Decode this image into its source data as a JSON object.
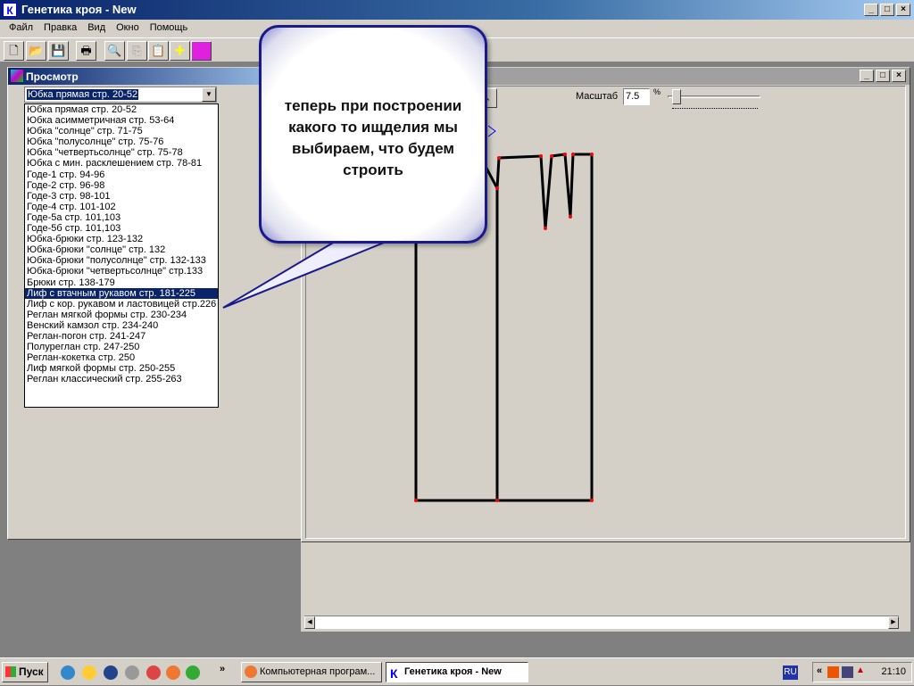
{
  "app": {
    "title": "Генетика кроя - New",
    "icon_letter": "К"
  },
  "menu": [
    "Файл",
    "Правка",
    "Вид",
    "Окно",
    "Помощь"
  ],
  "toolbar": [
    "new-icon",
    "open-icon",
    "save-icon",
    "print-icon",
    "preview-icon",
    "copy-icon",
    "paste-icon",
    "cross-icon",
    "people-icon"
  ],
  "preview": {
    "title": "Просмотр",
    "selected": "Юбка прямая стр. 20-52",
    "items": [
      "Юбка прямая стр. 20-52",
      "Юбка асимметричная стр. 53-64",
      "Юбка \"солнце\" стр. 71-75",
      "Юбка \"полусолнце\" стр. 75-76",
      "Юбка \"четвертьсолнце\" стр. 75-78",
      "Юбка с мин. расклешением стр. 78-81",
      "Годе-1 стр. 94-96",
      "Годе-2 стр. 96-98",
      "Годе-3 стр. 98-101",
      "Годе-4 стр. 101-102",
      "Годе-5а стр. 101,103",
      "Годе-5б стр. 101,103",
      "Юбка-брюки стр. 123-132",
      "Юбка-брюки \"солнце\" стр. 132",
      "Юбка-брюки \"полусолнце\" стр. 132-133",
      "Юбка-брюки \"четвертьсолнце\" стр.133",
      "Брюки стр. 138-179",
      "Лиф с втачным рукавом стр. 181-225",
      "Лиф с кор. рукавом и ластовицей стр.226",
      "Реглан мягкой формы стр. 230-234",
      "Венский камзол стр. 234-240",
      "Реглан-погон стр. 241-247",
      "Полуреглан стр. 247-250",
      "Реглан-кокетка стр. 250",
      "Лиф мягкой формы стр. 250-255",
      "Реглан классический стр. 255-263"
    ],
    "highlighted_index": 17
  },
  "drawing": {
    "scale_label": "Масштаб",
    "scale_value": "7.5",
    "percent": "%",
    "slider_fraction": 0.05
  },
  "callout": {
    "text": "теперь при построении какого то ищделия мы выбираем, что будем строить"
  },
  "taskbar": {
    "start": "Пуск",
    "tasks": [
      "Компьютерная програм...",
      "Генетика кроя - New"
    ],
    "lang": "RU",
    "clock": "21:10",
    "chevrons": "»",
    "tray_chevron": "«"
  }
}
